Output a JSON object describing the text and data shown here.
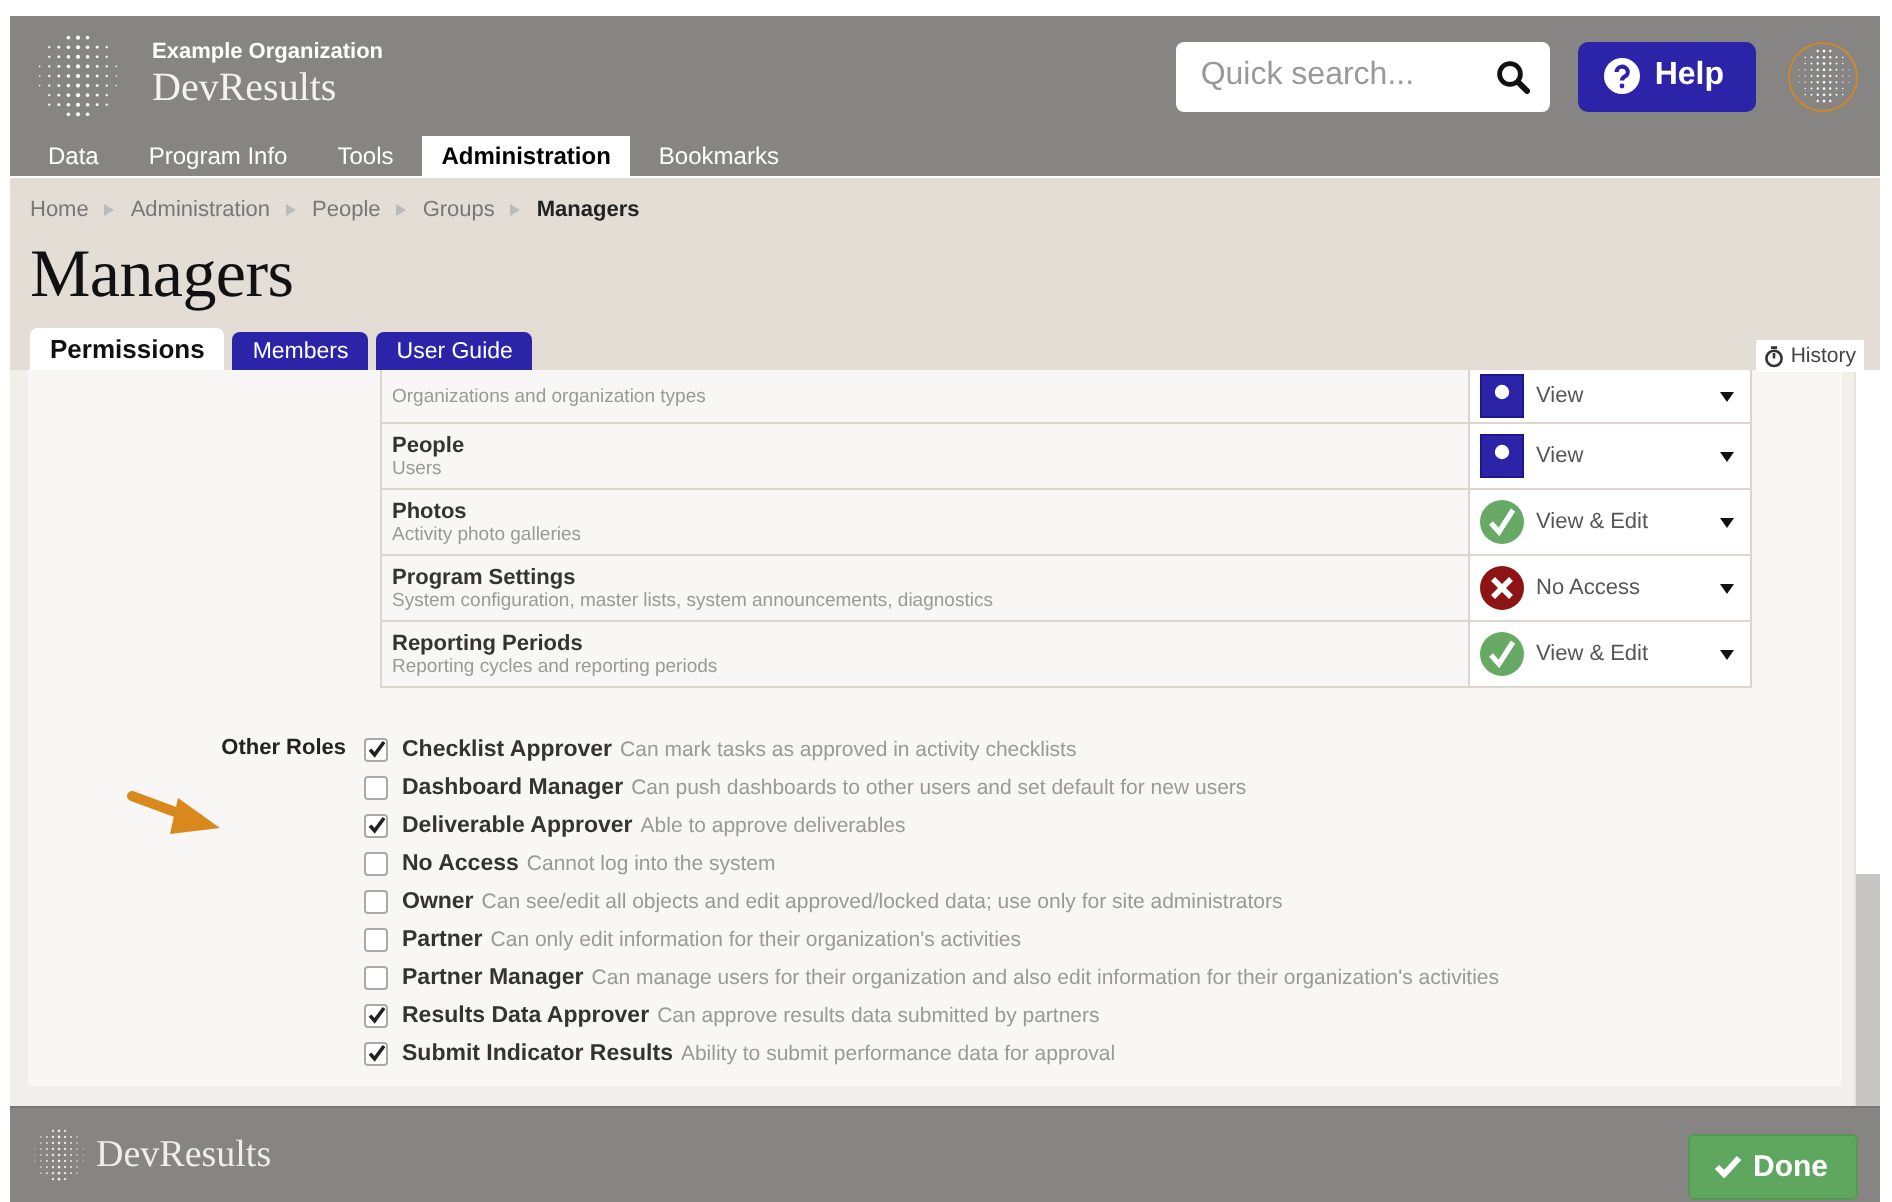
{
  "header": {
    "organization": "Example Organization",
    "app_name": "DevResults",
    "search": {
      "placeholder": "Quick search..."
    },
    "help_button": "Help"
  },
  "nav": [
    {
      "label": "Data",
      "selected": false
    },
    {
      "label": "Program Info",
      "selected": false
    },
    {
      "label": "Tools",
      "selected": false
    },
    {
      "label": "Administration",
      "selected": true
    },
    {
      "label": "Bookmarks",
      "selected": false
    }
  ],
  "breadcrumbs": [
    {
      "label": "Home",
      "current": false
    },
    {
      "label": "Administration",
      "current": false
    },
    {
      "label": "People",
      "current": false
    },
    {
      "label": "Groups",
      "current": false
    },
    {
      "label": "Managers",
      "current": true
    }
  ],
  "page_title": "Managers",
  "tabs": [
    {
      "label": "Permissions",
      "selected": true
    },
    {
      "label": "Members",
      "selected": false
    },
    {
      "label": "User Guide",
      "selected": false
    }
  ],
  "history_button": "History",
  "permissions": [
    {
      "description": "Organizations and organization types",
      "access": {
        "kind": "view",
        "label": "View"
      }
    },
    {
      "title": "People",
      "description": "Users",
      "access": {
        "kind": "view",
        "label": "View"
      }
    },
    {
      "title": "Photos",
      "description": "Activity photo galleries",
      "access": {
        "kind": "view_edit",
        "label": "View & Edit"
      }
    },
    {
      "title": "Program Settings",
      "description": "System configuration, master lists, system announcements, diagnostics",
      "access": {
        "kind": "no_access",
        "label": "No Access"
      }
    },
    {
      "title": "Reporting Periods",
      "description": "Reporting cycles and reporting periods",
      "access": {
        "kind": "view_edit",
        "label": "View & Edit"
      }
    }
  ],
  "other_roles": {
    "label": "Other Roles",
    "roles": [
      {
        "name": "Checklist Approver",
        "description": "Can mark tasks as approved in activity checklists",
        "checked": true
      },
      {
        "name": "Dashboard Manager",
        "description": "Can push dashboards to other users and set default for new users",
        "checked": false
      },
      {
        "name": "Deliverable Approver",
        "description": "Able to approve deliverables",
        "checked": true
      },
      {
        "name": "No Access",
        "description": "Cannot log into the system",
        "checked": false
      },
      {
        "name": "Owner",
        "description": "Can see/edit all objects and edit approved/locked data; use only for site administrators",
        "checked": false
      },
      {
        "name": "Partner",
        "description": "Can only edit information for their organization's activities",
        "checked": false
      },
      {
        "name": "Partner Manager",
        "description": "Can manage users for their organization and also edit information for their organization's activities",
        "checked": false
      },
      {
        "name": "Results Data Approver",
        "description": "Can approve results data submitted by partners",
        "checked": true
      },
      {
        "name": "Submit Indicator Results",
        "description": "Ability to submit performance data for approval",
        "checked": true
      }
    ]
  },
  "footer": {
    "app_name": "DevResults",
    "done_button": "Done"
  }
}
